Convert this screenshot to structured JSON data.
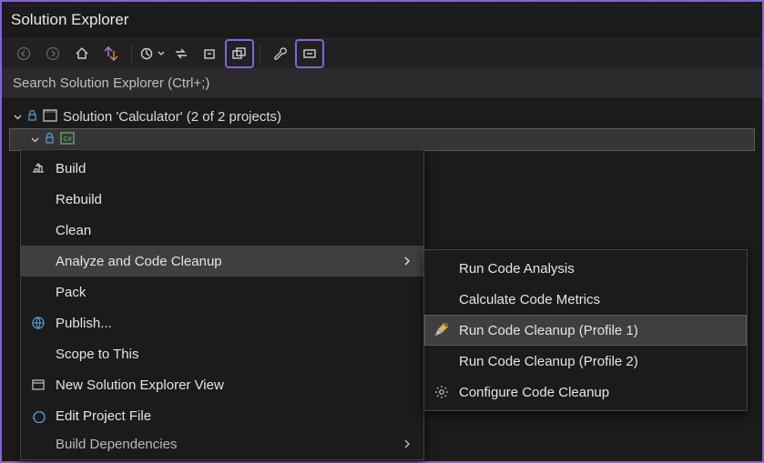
{
  "panel": {
    "title": "Solution Explorer"
  },
  "search": {
    "placeholder": "Search Solution Explorer (Ctrl+;)"
  },
  "tree": {
    "solution_label": "Solution 'Calculator' (2 of 2 projects)"
  },
  "context_menu": {
    "items": [
      "Build",
      "Rebuild",
      "Clean",
      "Analyze and Code Cleanup",
      "Pack",
      "Publish...",
      "Scope to This",
      "New Solution Explorer View",
      "Edit Project File",
      "Build Dependencies"
    ],
    "submenu_index": 3
  },
  "submenu": {
    "items": [
      "Run Code Analysis",
      "Calculate Code Metrics",
      "Run Code Cleanup (Profile 1)",
      "Run Code Cleanup (Profile 2)",
      "Configure Code Cleanup"
    ],
    "highlight_index": 2
  }
}
